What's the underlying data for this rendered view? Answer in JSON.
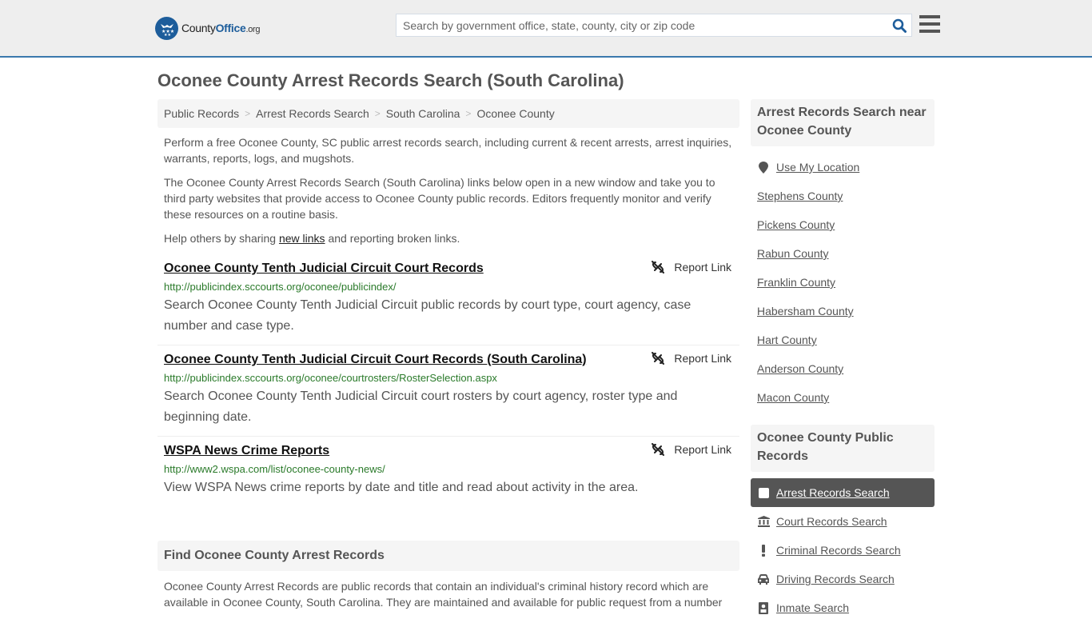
{
  "header": {
    "logo": {
      "brand_prefix": "County",
      "brand_main": "Office",
      "brand_tld": ".org",
      "icon": "eagle-stars-badge-icon"
    },
    "search": {
      "placeholder": "Search by government office, state, county, city or zip code",
      "value": "",
      "icon": "search-icon"
    },
    "menu_icon": "hamburger-menu-icon"
  },
  "page": {
    "title": "Oconee County Arrest Records Search (South Carolina)"
  },
  "breadcrumb": [
    {
      "label": "Public Records"
    },
    {
      "label": "Arrest Records Search"
    },
    {
      "label": "South Carolina"
    },
    {
      "label": "Oconee County"
    }
  ],
  "intro": {
    "p1": "Perform a free Oconee County, SC public arrest records search, including current & recent arrests, arrest inquiries, warrants, reports, logs, and mugshots.",
    "p2": "The Oconee County Arrest Records Search (South Carolina) links below open in a new window and take you to third party websites that provide access to Oconee County public records. Editors frequently monitor and verify these resources on a routine basis.",
    "p3_before": "Help others by sharing ",
    "p3_link": "new links",
    "p3_after": " and reporting broken links."
  },
  "results": [
    {
      "title": "Oconee County Tenth Judicial Circuit Court Records",
      "url": "http://publicindex.sccourts.org/oconee/publicindex/",
      "description": "Search Oconee County Tenth Judicial Circuit public records by court type, court agency, case number and case type.",
      "report_label": "Report Link"
    },
    {
      "title": "Oconee County Tenth Judicial Circuit Court Records (South Carolina)",
      "url": "http://publicindex.sccourts.org/oconee/courtrosters/RosterSelection.aspx",
      "description": "Search Oconee County Tenth Judicial Circuit court rosters by court agency, roster type and beginning date.",
      "report_label": "Report Link"
    },
    {
      "title": "WSPA News Crime Reports",
      "url": "http://www2.wspa.com/list/oconee-county-news/",
      "description": "View WSPA News crime reports by date and title and read about activity in the area.",
      "report_label": "Report Link"
    }
  ],
  "find_section": {
    "heading": "Find Oconee County Arrest Records",
    "text": "Oconee County Arrest Records are public records that contain an individual's criminal history record which are available in Oconee County, South Carolina. They are maintained and available for public request from a number"
  },
  "sidebar": {
    "nearby_heading": "Arrest Records Search near Oconee County",
    "use_location": "Use My Location",
    "nearby": [
      "Stephens County",
      "Pickens County",
      "Rabun County",
      "Franklin County",
      "Habersham County",
      "Hart County",
      "Anderson County",
      "Macon County"
    ],
    "public_records_heading": "Oconee County Public Records",
    "public_records": [
      {
        "label": "Arrest Records Search",
        "icon": "square-icon",
        "active": true
      },
      {
        "label": "Court Records Search",
        "icon": "courthouse-icon",
        "active": false
      },
      {
        "label": "Criminal Records Search",
        "icon": "exclamation-icon",
        "active": false
      },
      {
        "label": "Driving Records Search",
        "icon": "car-icon",
        "active": false
      },
      {
        "label": "Inmate Search",
        "icon": "inmate-icon",
        "active": false
      }
    ]
  },
  "colors": {
    "brand_blue": "#1d5d9b",
    "header_border": "#3b79ad",
    "url_green": "#2a7a2a",
    "active_item_bg": "#555555"
  }
}
